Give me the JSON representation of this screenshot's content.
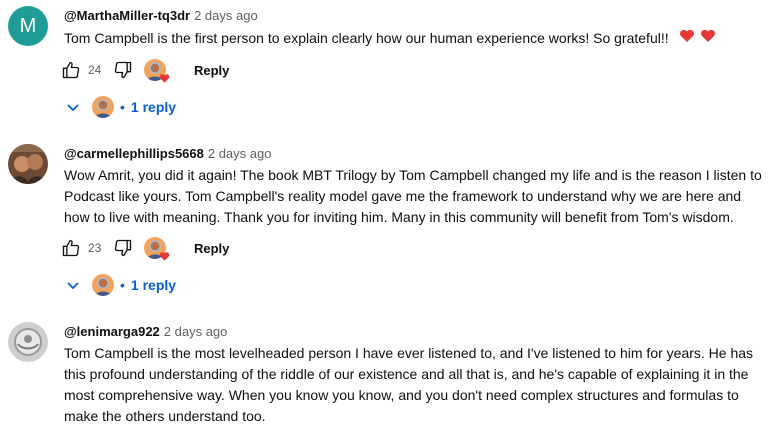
{
  "comments": [
    {
      "avatar_letter": "M",
      "author": "@MarthaMiller-tq3dr",
      "time": "2 days ago",
      "text": "Tom Campbell is the first person to explain clearly how our human experience works! So grateful!!",
      "likes": "24",
      "reply_label": "Reply",
      "replies_label": "1 reply"
    },
    {
      "author": "@carmellephillips5668",
      "time": "2 days ago",
      "text": "Wow Amrit, you did it again!  The book MBT Trilogy by Tom Campbell changed my life and is the reason I listen to Podcast like yours. Tom Campbell's reality model gave me the framework to understand why we are here and how to live with meaning. Thank you for inviting him. Many in this community will benefit from Tom's wisdom.",
      "likes": "23",
      "reply_label": "Reply",
      "replies_label": "1 reply"
    },
    {
      "author": "@lenimarga922",
      "time": "2 days ago",
      "text": "Tom Campbell is the most levelheaded person I have ever listened to, and I've listened to him for years.  He has this profound understanding of the riddle of our existence and all that is, and he's capable of explaining it in the most comprehensive way.  When you know you know, and you don't need complex structures and formulas to make the others understand too."
    }
  ],
  "colors": {
    "avatar_teal": "#1e9c95",
    "link_blue": "#065fd4",
    "heart_red": "#e53935"
  }
}
